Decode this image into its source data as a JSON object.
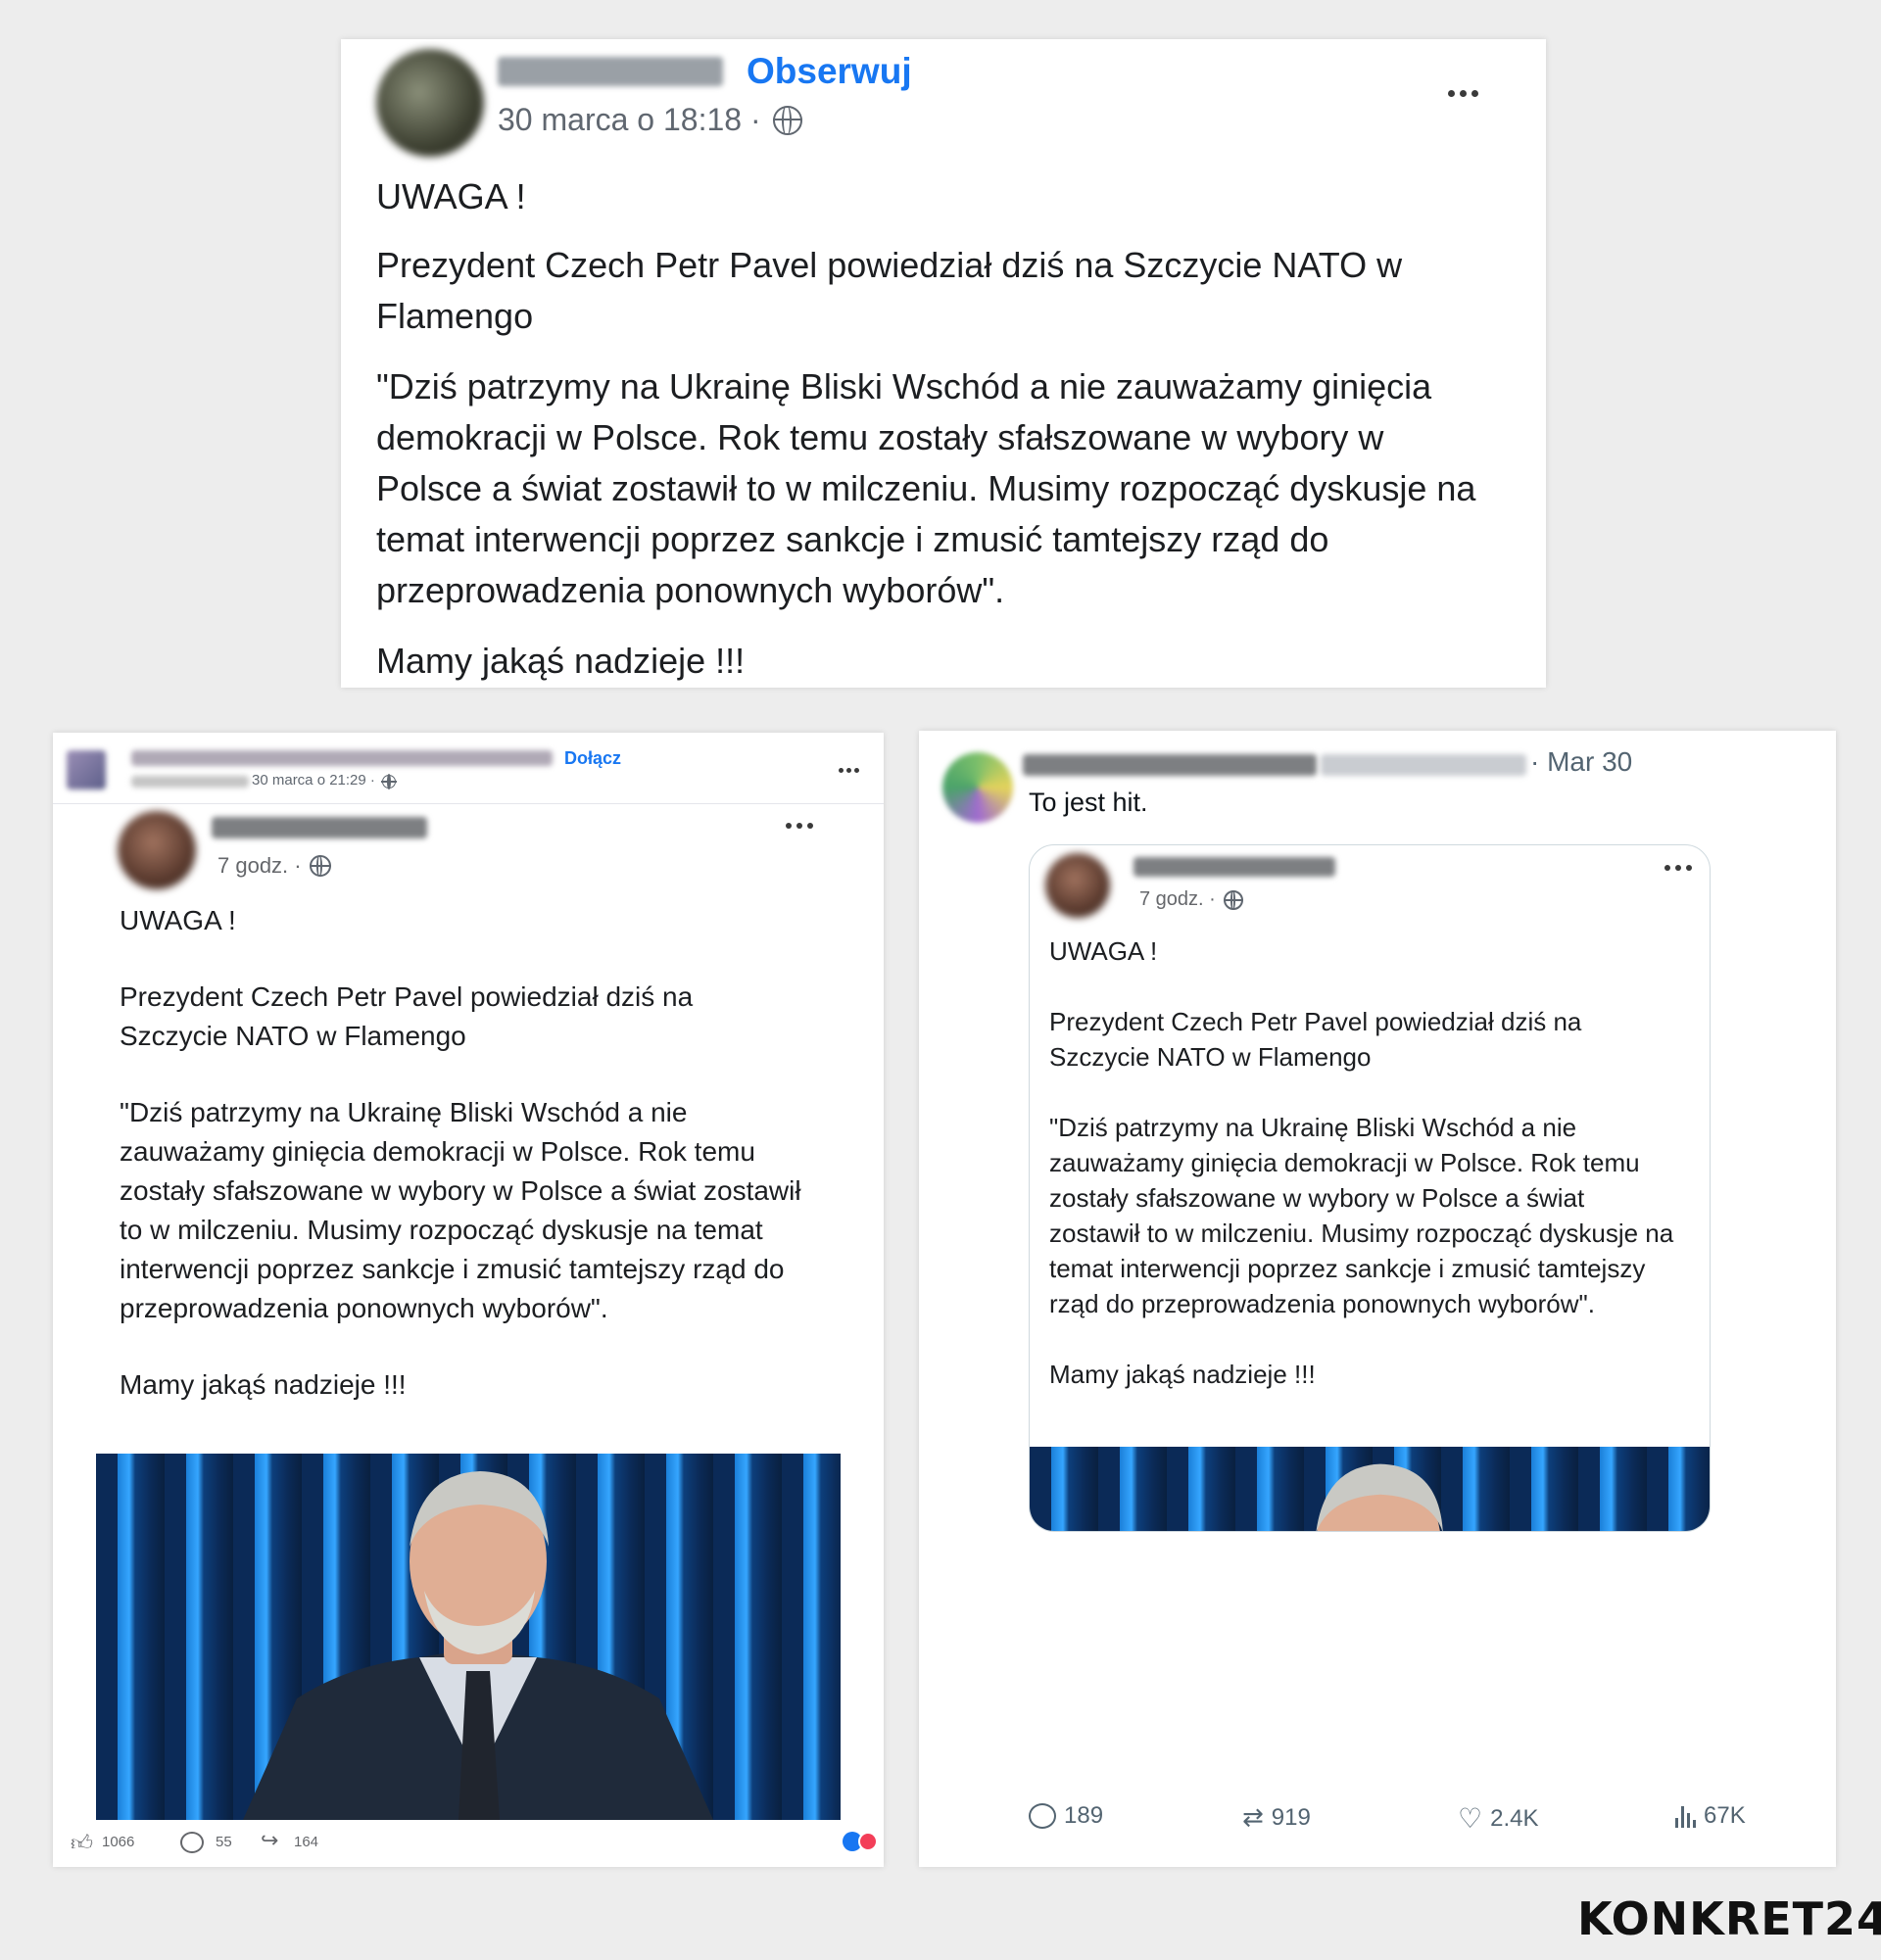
{
  "top_post": {
    "follow_label": "Obserwuj",
    "timestamp": "30 marca o 18:18 ·",
    "paragraphs": [
      "UWAGA !",
      "Prezydent Czech Petr Pavel powiedział dziś na Szczycie NATO w Flamengo",
      "\"Dziś patrzymy na Ukrainę Bliski Wschód a nie zauważamy ginięcia demokracji w Polsce. Rok temu zostały sfałszowane w wybory w Polsce a świat zostawił to w milczeniu. Musimy rozpocząć dyskusje na temat interwencji poprzez sankcje i zmusić tamtejszy rząd do przeprowadzenia ponownych wyborów\".",
      "Mamy jakąś nadzieje !!!"
    ]
  },
  "left_post": {
    "join_label": "Dołącz",
    "group_timestamp": "30 marca o 21:29 ·",
    "inner_timestamp": "7 godz. ·",
    "paragraphs": [
      "UWAGA !",
      "Prezydent Czech Petr Pavel powiedział dziś na Szczycie NATO w Flamengo",
      "\"Dziś patrzymy na Ukrainę Bliski Wschód a nie zauważamy ginięcia demokracji w Polsce. Rok temu zostały sfałszowane w wybory w Polsce a świat zostawił to w milczeniu. Musimy rozpocząć dyskusje na temat interwencji poprzez sankcje i zmusić tamtejszy rząd do przeprowadzenia ponownych wyborów\".",
      "Mamy jakąś nadzieje !!!"
    ],
    "likes": "1066",
    "comments": "55",
    "shares": "164"
  },
  "right_post": {
    "date": "· Mar 30",
    "tweet_text": "To jest hit.",
    "inner_timestamp": "7 godz. ·",
    "paragraphs": [
      "UWAGA !",
      "Prezydent Czech Petr Pavel powiedział dziś na Szczycie NATO w Flamengo",
      "\"Dziś patrzymy na Ukrainę Bliski Wschód a nie zauważamy ginięcia demokracji w Polsce. Rok temu zostały sfałszowane w wybory w Polsce a świat zostawił to w milczeniu. Musimy rozpocząć dyskusje na temat interwencji poprzez sankcje i zmusić tamtejszy rząd do przeprowadzenia ponownych wyborów\".",
      "Mamy jakąś nadzieje !!!"
    ],
    "replies": "189",
    "retweets": "919",
    "likes": "2.4K",
    "views": "67K"
  },
  "brand": {
    "logo_text": "KONKRET24"
  },
  "colors": {
    "facebook_blue": "#1877f2",
    "twitter_gray": "#536471"
  }
}
